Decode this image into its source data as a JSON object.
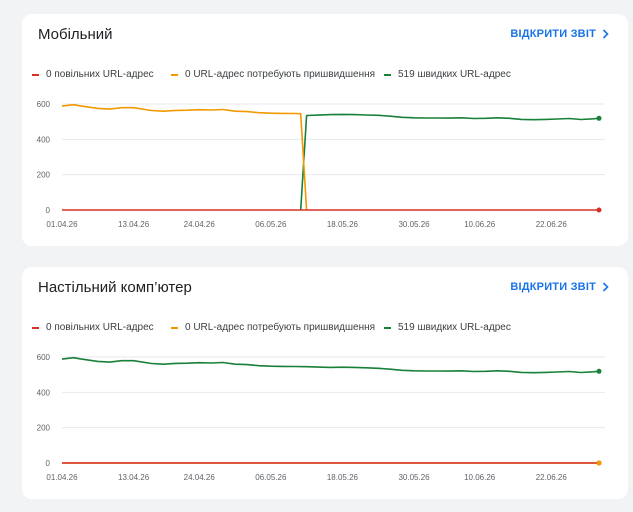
{
  "cards": [
    {
      "title": "Мобільний",
      "open_report": "ВІДКРИТИ ЗВІТ",
      "legend": [
        {
          "label": "0 повільних URL-адрес",
          "color": "#d93025"
        },
        {
          "label": "0 URL-адрес потребують пришвидшення",
          "color": "#f29900"
        },
        {
          "label": "519 швидких URL-адрес",
          "color": "#188038"
        }
      ]
    },
    {
      "title": "Настільний комп’ютер",
      "open_report": "ВІДКРИТИ ЗВІТ",
      "legend": [
        {
          "label": "0 повільних URL-адрес",
          "color": "#d93025"
        },
        {
          "label": "0 URL-адрес потребують пришвидшення",
          "color": "#f29900"
        },
        {
          "label": "519 швидких URL-адрес",
          "color": "#188038"
        }
      ]
    }
  ],
  "chart_data": [
    {
      "type": "line",
      "title": "Мобільний",
      "x_ticks": [
        "01.04.26",
        "13.04.26",
        "24.04.26",
        "06.05.26",
        "18.05.26",
        "30.05.26",
        "10.06.26",
        "22.06.26"
      ],
      "y_ticks": [
        "0",
        "200",
        "400",
        "600"
      ],
      "ylim": [
        0,
        600
      ],
      "x_start": "01.04.26",
      "x_end": "30.06.26",
      "grid": true,
      "legend_position": "top",
      "series": [
        {
          "name": "0 повільних URL-адрес",
          "color": "#d93025",
          "x": [
            "01.04.26",
            "30.06.26"
          ],
          "values": [
            0,
            0
          ]
        },
        {
          "name": "0 URL-адрес потребують пришвидшення",
          "color": "#f29900",
          "x": [
            "01.04.26",
            "03.04.26",
            "04.04.26",
            "07.04.26",
            "09.04.26",
            "11.04.26",
            "13.04.26",
            "16.04.26",
            "18.04.26",
            "20.04.26",
            "22.04.26",
            "24.04.26",
            "26.04.26",
            "28.04.26",
            "30.04.26",
            "02.05.26",
            "04.05.26",
            "06.05.26",
            "08.05.26",
            "10.05.26",
            "11.05.26",
            "12.05.26"
          ],
          "values": [
            588,
            596,
            590,
            575,
            571,
            579,
            579,
            563,
            559,
            564,
            565,
            568,
            566,
            569,
            559,
            557,
            551,
            548,
            547,
            546,
            545,
            0
          ]
        },
        {
          "name": "519 швидких URL-адрес",
          "color": "#188038",
          "x": [
            "11.05.26",
            "12.05.26",
            "14.05.26",
            "16.05.26",
            "18.05.26",
            "20.05.26",
            "22.05.26",
            "24.05.26",
            "26.05.26",
            "28.05.26",
            "30.05.26",
            "01.06.26",
            "03.06.26",
            "05.06.26",
            "07.06.26",
            "09.06.26",
            "11.06.26",
            "13.06.26",
            "15.06.26",
            "17.06.26",
            "19.06.26",
            "21.06.26",
            "23.06.26",
            "25.06.26",
            "27.06.26",
            "29.06.26",
            "30.06.26"
          ],
          "values": [
            0,
            535,
            537,
            540,
            541,
            540,
            538,
            536,
            531,
            525,
            522,
            521,
            521,
            520,
            522,
            518,
            519,
            522,
            519,
            513,
            511,
            513,
            515,
            518,
            512,
            516,
            519
          ]
        }
      ]
    },
    {
      "type": "line",
      "title": "Настільний комп’ютер",
      "x_ticks": [
        "01.04.26",
        "13.04.26",
        "24.04.26",
        "06.05.26",
        "18.05.26",
        "30.05.26",
        "10.06.26",
        "22.06.26"
      ],
      "y_ticks": [
        "0",
        "200",
        "400",
        "600"
      ],
      "ylim": [
        0,
        600
      ],
      "x_start": "01.04.26",
      "x_end": "30.06.26",
      "grid": true,
      "legend_position": "top",
      "series": [
        {
          "name": "0 повільних URL-адрес",
          "color": "#d93025",
          "x": [
            "01.04.26",
            "30.06.26"
          ],
          "values": [
            0,
            0
          ]
        },
        {
          "name": "0 URL-адрес потребують пришвидшення",
          "color": "#f29900",
          "x": [
            "01.04.26",
            "30.06.26"
          ],
          "values": [
            0,
            0
          ]
        },
        {
          "name": "519 швидких URL-адрес",
          "color": "#188038",
          "x": [
            "01.04.26",
            "03.04.26",
            "04.04.26",
            "07.04.26",
            "09.04.26",
            "11.04.26",
            "13.04.26",
            "16.04.26",
            "18.04.26",
            "20.04.26",
            "22.04.26",
            "24.04.26",
            "26.04.26",
            "28.04.26",
            "30.04.26",
            "02.05.26",
            "04.05.26",
            "06.05.26",
            "08.05.26",
            "10.05.26",
            "12.05.26",
            "14.05.26",
            "16.05.26",
            "18.05.26",
            "20.05.26",
            "22.05.26",
            "24.05.26",
            "26.05.26",
            "28.05.26",
            "30.05.26",
            "01.06.26",
            "03.06.26",
            "05.06.26",
            "07.06.26",
            "09.06.26",
            "11.06.26",
            "13.06.26",
            "15.06.26",
            "17.06.26",
            "19.06.26",
            "21.06.26",
            "23.06.26",
            "25.06.26",
            "27.06.26",
            "29.06.26",
            "30.06.26"
          ],
          "values": [
            588,
            596,
            590,
            575,
            571,
            579,
            579,
            563,
            559,
            564,
            565,
            568,
            566,
            569,
            559,
            557,
            551,
            548,
            547,
            546,
            545,
            543,
            541,
            542,
            541,
            539,
            536,
            531,
            525,
            522,
            521,
            521,
            520,
            522,
            518,
            519,
            522,
            519,
            513,
            511,
            513,
            515,
            518,
            512,
            516,
            519
          ]
        }
      ]
    }
  ]
}
